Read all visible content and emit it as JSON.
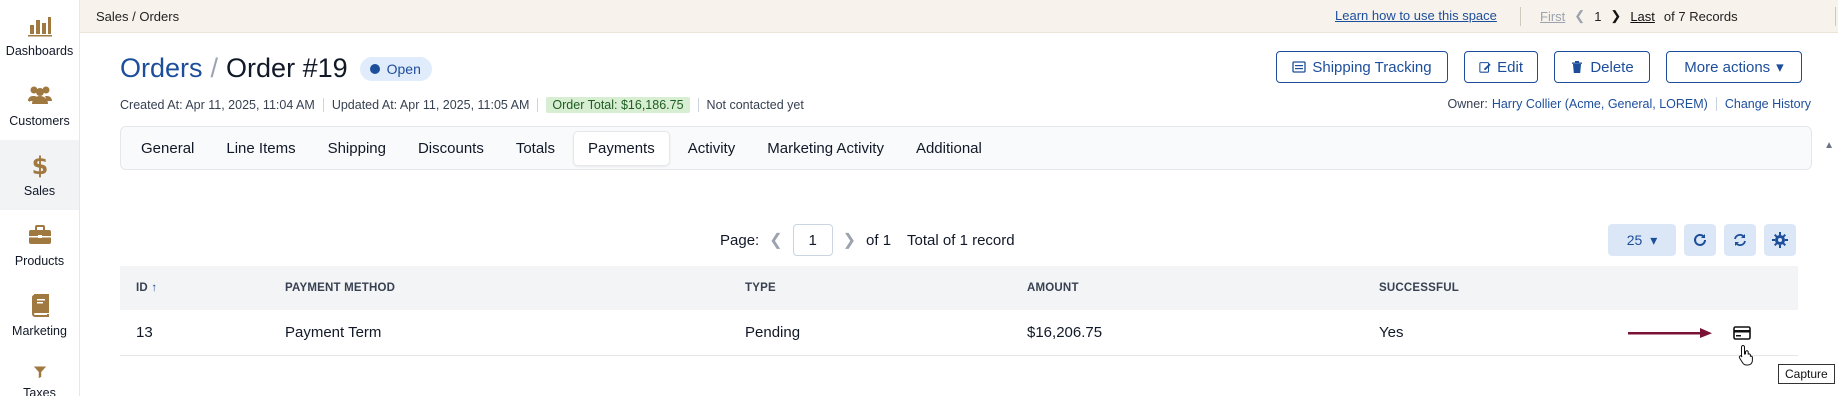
{
  "sidebar": {
    "items": [
      {
        "label": "Dashboards",
        "icon": "bar-chart-icon"
      },
      {
        "label": "Customers",
        "icon": "users-icon"
      },
      {
        "label": "Sales",
        "icon": "dollar-icon"
      },
      {
        "label": "Products",
        "icon": "briefcase-icon"
      },
      {
        "label": "Marketing",
        "icon": "book-icon"
      },
      {
        "label": "Taxes",
        "icon": "funnel-icon"
      }
    ]
  },
  "topbar": {
    "breadcrumb": "Sales / Orders",
    "learn_link": "Learn how to use this space",
    "first": "First",
    "page": "1",
    "last": "Last",
    "records": "of 7 Records"
  },
  "header": {
    "title_link": "Orders",
    "title_sep": "/",
    "title": "Order #19",
    "status": "Open",
    "created": "Created At: Apr 11, 2025, 11:04 AM",
    "updated": "Updated At: Apr 11, 2025, 11:05 AM",
    "order_total": "Order Total: $16,186.75",
    "contacted": "Not contacted yet",
    "owner_label": "Owner:",
    "owner_value": "Harry Collier (Acme, General, LOREM)",
    "change_history": "Change History",
    "buttons": {
      "shipping_tracking": "Shipping Tracking",
      "edit": "Edit",
      "delete": "Delete",
      "more_actions": "More actions"
    }
  },
  "tabs": [
    "General",
    "Line Items",
    "Shipping",
    "Discounts",
    "Totals",
    "Payments",
    "Activity",
    "Marketing Activity",
    "Additional"
  ],
  "active_tab": "Payments",
  "grid": {
    "page_label": "Page:",
    "page_value": "1",
    "of_pages": "of 1",
    "total": "Total of 1 record",
    "page_size": "25",
    "columns": [
      "ID",
      "PAYMENT METHOD",
      "TYPE",
      "AMOUNT",
      "SUCCESSFUL"
    ],
    "sort_indicator": "↑",
    "rows": [
      {
        "id": "13",
        "payment_method": "Payment Term",
        "type": "Pending",
        "amount": "$16,206.75",
        "successful": "Yes"
      }
    ],
    "tooltip": "Capture"
  },
  "colors": {
    "accent": "#1d4e9b",
    "topbar_bg": "#f7f3ec",
    "sidebar_icon": "#a07940",
    "arrow": "#7a1236",
    "badge_green_bg": "#d7eed3"
  }
}
